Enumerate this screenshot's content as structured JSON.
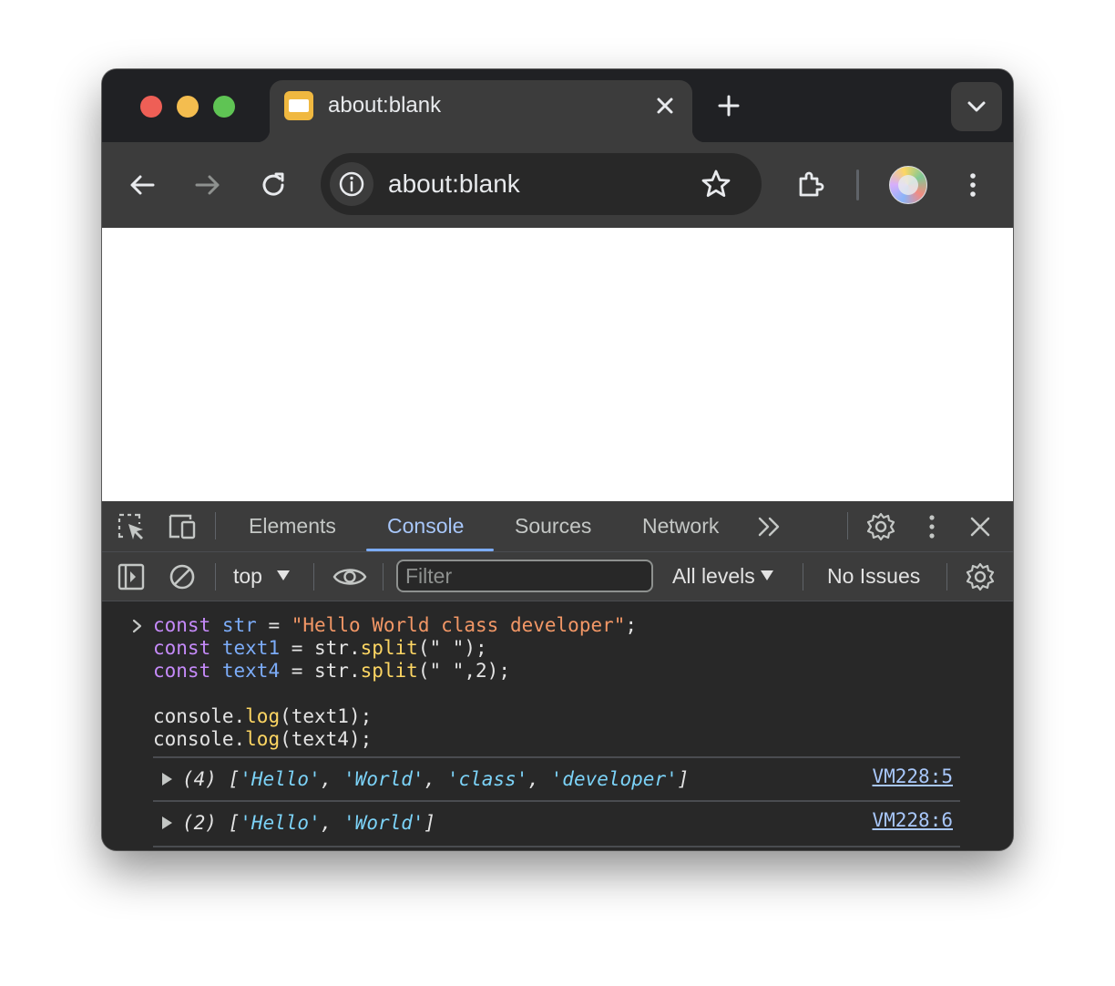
{
  "tab": {
    "title": "about:blank"
  },
  "omnibox": {
    "url": "about:blank"
  },
  "devtools": {
    "tabs": [
      "Elements",
      "Console",
      "Sources",
      "Network"
    ],
    "active_tab": "Console",
    "console_toolbar": {
      "context": "top",
      "filter_placeholder": "Filter",
      "levels": "All levels",
      "issues": "No Issues"
    },
    "code": {
      "line1": {
        "kw": "const",
        "var": "str",
        "op": " = ",
        "str": "\"Hello World class developer\"",
        "end": ";"
      },
      "line2": {
        "kw": "const",
        "var": "text1",
        "pre": " = str.",
        "fn": "split",
        "args": "(\" \");"
      },
      "line3": {
        "kw": "const",
        "var": "text4",
        "pre": " = str.",
        "fn": "split",
        "args": "(\" \",2);"
      },
      "line5": {
        "pre": "console.",
        "fn": "log",
        "args": "(text1);"
      },
      "line6": {
        "pre": "console.",
        "fn": "log",
        "args": "(text4);"
      }
    },
    "outputs": [
      {
        "count": "(4) [",
        "items": [
          "'Hello'",
          "'World'",
          "'class'",
          "'developer'"
        ],
        "close": "]",
        "source": "VM228:5"
      },
      {
        "count": "(2) [",
        "items": [
          "'Hello'",
          "'World'"
        ],
        "close": "]",
        "source": "VM228:6"
      }
    ]
  },
  "colors": {
    "keyword": "#c58af9",
    "variable": "#7cacf8",
    "string": "#f29766",
    "function": "#fdd663",
    "output_string": "#7cd3f8",
    "active_tab": "#a8c7fa"
  },
  "icons": [
    "close-icon",
    "plus-icon",
    "chevron-down-icon",
    "back-arrow-icon",
    "forward-arrow-icon",
    "reload-icon",
    "info-icon",
    "star-icon",
    "extensions-icon",
    "kebab-menu-icon",
    "inspect-element-icon",
    "device-toolbar-icon",
    "more-tabs-icon",
    "settings-icon",
    "sidebar-toggle-icon",
    "clear-console-icon",
    "eye-icon"
  ]
}
